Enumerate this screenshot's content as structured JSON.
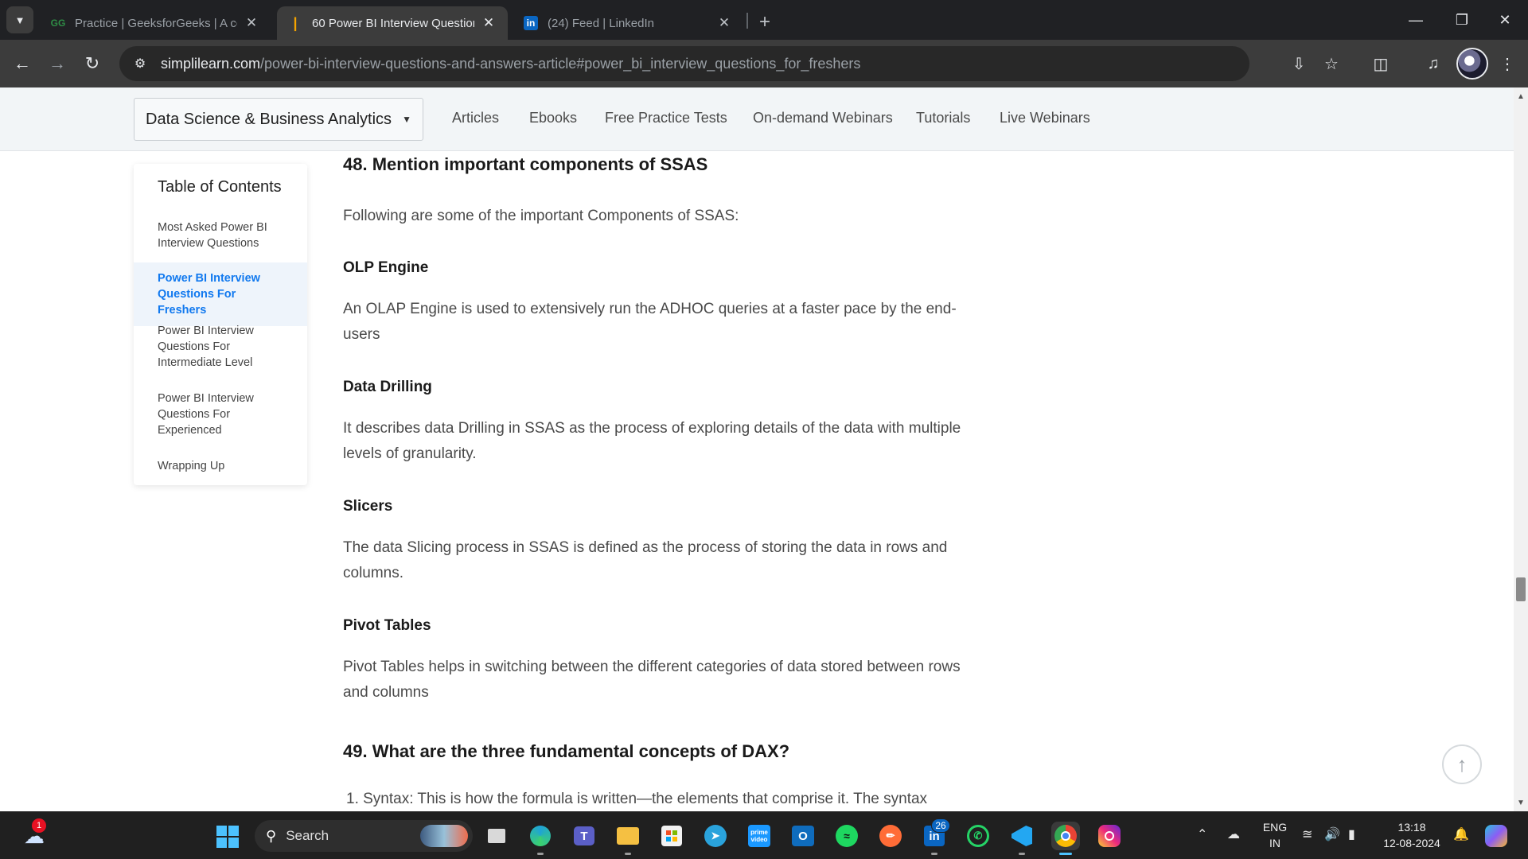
{
  "tabs": [
    {
      "title": "Practice | GeeksforGeeks | A co",
      "favicon": "GG",
      "favicon_color": "#2f8d46",
      "active": false
    },
    {
      "title": "60 Power BI Interview Question",
      "favicon": "|",
      "favicon_color": "#f4a300",
      "active": true
    },
    {
      "title": "(24) Feed | LinkedIn",
      "favicon": "in",
      "favicon_color": "#0a66c2",
      "active": false
    }
  ],
  "address_bar": {
    "host": "simplilearn.com",
    "path": "/power-bi-interview-questions-and-answers-article#power_bi_interview_questions_for_freshers"
  },
  "subnav": {
    "category": "Data Science & Business Analytics",
    "links": [
      "Articles",
      "Ebooks",
      "Free Practice Tests",
      "On-demand Webinars",
      "Tutorials",
      "Live Webinars"
    ]
  },
  "toc": {
    "title": "Table of Contents",
    "items": [
      {
        "label": "Most Asked Power BI Interview Questions",
        "active": false
      },
      {
        "label": "Power BI Interview Questions For Freshers",
        "active": true
      },
      {
        "label": "Power BI Interview Questions For Intermediate Level",
        "active": false
      },
      {
        "label": "Power BI Interview Questions For Experienced",
        "active": false
      },
      {
        "label": "Wrapping Up",
        "active": false
      }
    ]
  },
  "article": {
    "q48": "48. Mention important components of SSAS",
    "intro": "Following are some of the important Components of SSAS:",
    "sections": [
      {
        "heading": "OLP Engine",
        "text": "An OLAP Engine is used to extensively run the ADHOC queries at a faster pace by the end-users"
      },
      {
        "heading": "Data Drilling",
        "text": "It describes data Drilling in SSAS as the process of exploring details of the data with multiple levels of granularity."
      },
      {
        "heading": "Slicers",
        "text": "The data Slicing process in SSAS is defined as the process of storing the data in rows and columns."
      },
      {
        "heading": "Pivot Tables",
        "text": "Pivot Tables helps in switching between the  different categories of data stored between rows and columns"
      }
    ],
    "q49": "49. What are the three fundamental concepts of DAX?",
    "list_first": "1. Syntax: This is how the formula is written—the elements that comprise it. The syntax"
  },
  "taskbar": {
    "weather_badge": "1",
    "search_label": "Search",
    "linkedin_badge": "26",
    "lang_top": "ENG",
    "lang_bottom": "IN",
    "time": "13:18",
    "date": "12-08-2024",
    "apps": [
      {
        "name": "task-view",
        "color": "#d9d9d9"
      },
      {
        "name": "edge",
        "color": "#1fa3d6"
      },
      {
        "name": "teams",
        "color": "#5b5fc7"
      },
      {
        "name": "file-explorer",
        "color": "#f5c042"
      },
      {
        "name": "microsoft-store",
        "color": "#f2f2f2"
      },
      {
        "name": "telegram",
        "color": "#2aa3dc"
      },
      {
        "name": "prime-video",
        "color": "#1a98ff"
      },
      {
        "name": "outlook",
        "color": "#0f6cbd"
      },
      {
        "name": "spotify",
        "color": "#1ed760"
      },
      {
        "name": "postman",
        "color": "#ff6c37"
      },
      {
        "name": "linkedin",
        "color": "#0a66c2"
      },
      {
        "name": "whatsapp",
        "color": "#25d366"
      },
      {
        "name": "vscode",
        "color": "#23a7f2"
      },
      {
        "name": "chrome",
        "color": "#e9b321"
      },
      {
        "name": "instagram",
        "color": "#d6249f"
      }
    ]
  }
}
